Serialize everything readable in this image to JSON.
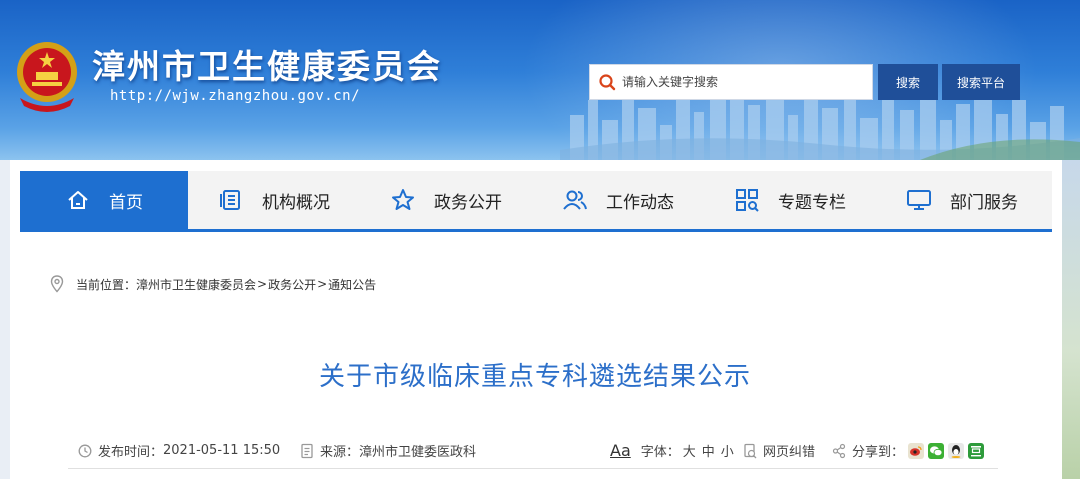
{
  "header": {
    "site_title": "漳州市卫生健康委员会",
    "site_url": "http://wjw.zhangzhou.gov.cn/",
    "search_placeholder": "请输入关键字搜索",
    "search_button": "搜索",
    "platform_button": "搜索平台"
  },
  "nav": {
    "items": [
      {
        "label": "首页",
        "icon": "home-icon"
      },
      {
        "label": "机构概况",
        "icon": "document-list-icon"
      },
      {
        "label": "政务公开",
        "icon": "star-icon"
      },
      {
        "label": "工作动态",
        "icon": "users-icon"
      },
      {
        "label": "专题专栏",
        "icon": "grid-search-icon"
      },
      {
        "label": "部门服务",
        "icon": "monitor-icon"
      }
    ],
    "active_index": 0
  },
  "breadcrumb": {
    "prefix": "当前位置：",
    "items": [
      "漳州市卫生健康委员会",
      "政务公开",
      "通知公告"
    ],
    "separator": ">"
  },
  "article": {
    "title": "关于市级临床重点专科遴选结果公示",
    "publish_label": "发布时间：",
    "publish_time": "2021-05-11 15:50",
    "source_label": "来源：",
    "source": "漳州市卫健委医政科",
    "font_aa": "Aa",
    "font_label": "字体：",
    "font_sizes": [
      "大",
      "中",
      "小"
    ],
    "correction": "网页纠错",
    "share_label": "分享到："
  },
  "colors": {
    "nav_active": "#1e6fd0",
    "title_blue": "#2c6fc9",
    "button_navy": "#1f4f99"
  }
}
